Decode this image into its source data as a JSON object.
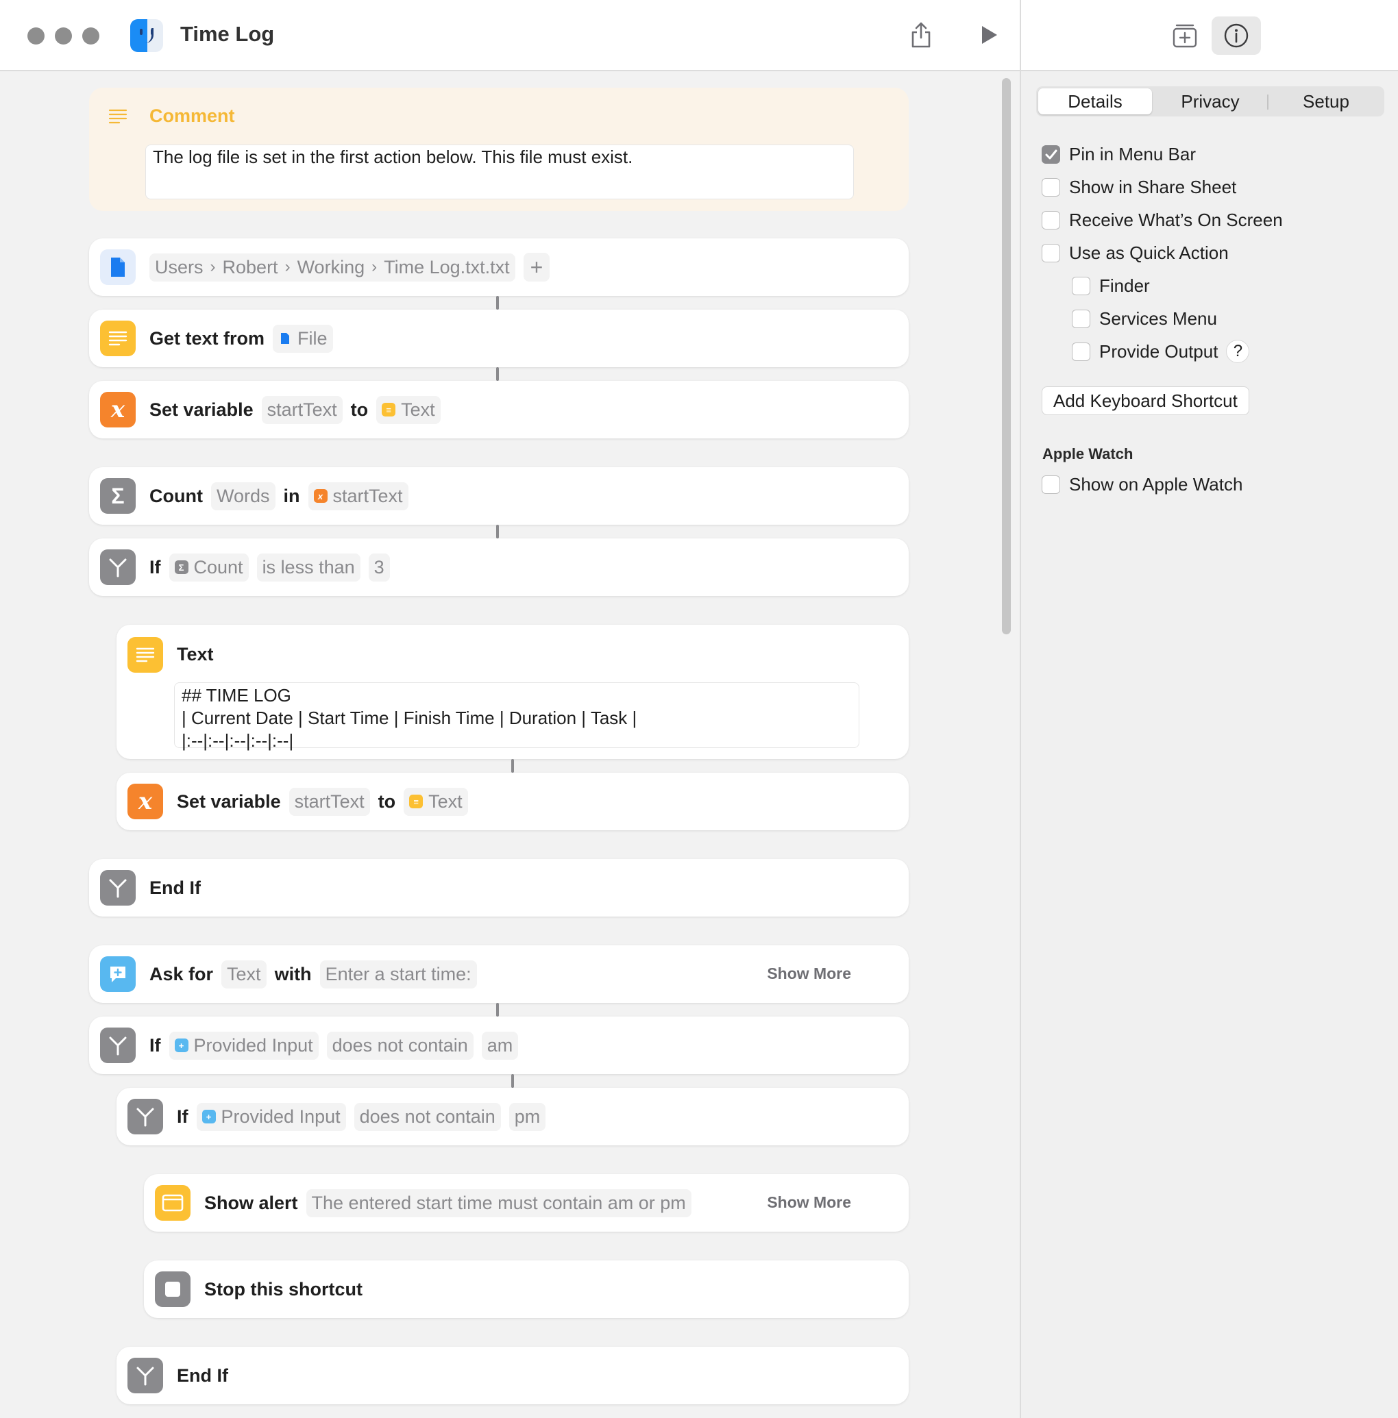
{
  "window": {
    "title": "Time Log"
  },
  "comment": {
    "title": "Comment",
    "text": "The log file is set in the first action below. This file must exist."
  },
  "file_path": {
    "segments": [
      "Users",
      "Robert",
      "Working",
      "Time Log.txt.txt"
    ],
    "add_glyph": "+"
  },
  "actions": {
    "get_text": {
      "label": "Get text from",
      "source": "File"
    },
    "set_var1": {
      "label": "Set variable",
      "var": "startText",
      "to": "to",
      "value": "Text"
    },
    "count": {
      "label": "Count",
      "unit": "Words",
      "in": "in",
      "source": "startText"
    },
    "if1": {
      "label": "If",
      "subject": "Count",
      "op": "is less than",
      "value": "3"
    },
    "text": {
      "label": "Text",
      "lines": [
        "## TIME LOG",
        "| Current Date | Start Time | Finish Time | Duration | Task |",
        "|:--|:--|:--|:--|:--|"
      ]
    },
    "set_var2": {
      "label": "Set variable",
      "var": "startText",
      "to": "to",
      "value": "Text"
    },
    "end_if1": {
      "label": "End If"
    },
    "ask": {
      "label": "Ask for",
      "type": "Text",
      "with": "with",
      "prompt": "Enter a start time:",
      "show_more": "Show More"
    },
    "if2": {
      "label": "If",
      "subject": "Provided Input",
      "op": "does not contain",
      "value": "am"
    },
    "if3": {
      "label": "If",
      "subject": "Provided Input",
      "op": "does not contain",
      "value": "pm"
    },
    "alert": {
      "label": "Show alert",
      "message": "The entered start time must contain am or pm",
      "show_more": "Show More"
    },
    "stop": {
      "label": "Stop this shortcut"
    },
    "end_if2": {
      "label": "End If"
    }
  },
  "panel": {
    "tabs": [
      "Details",
      "Privacy",
      "Setup"
    ],
    "options": {
      "pin_menu_bar": "Pin in Menu Bar",
      "share_sheet": "Show in Share Sheet",
      "receive_screen": "Receive What’s On Screen",
      "quick_action": "Use as Quick Action",
      "finder": "Finder",
      "services_menu": "Services Menu",
      "provide_output": "Provide Output"
    },
    "help_glyph": "?",
    "keyboard_shortcut": "Add Keyboard Shortcut",
    "apple_watch_header": "Apple Watch",
    "apple_watch_option": "Show on Apple Watch",
    "checked": {
      "pin_menu_bar": true,
      "share_sheet": false,
      "receive_screen": false,
      "quick_action": false,
      "finder": false,
      "services_menu": false,
      "provide_output": false,
      "apple_watch": false
    }
  },
  "colors": {
    "text_icon": "#fcc033",
    "variable_icon": "#f5842c",
    "control_icon": "#8a8a8d",
    "ask_icon": "#58b8f0",
    "comment_bg": "#fbf3e8",
    "comment_title": "#f5b836"
  }
}
